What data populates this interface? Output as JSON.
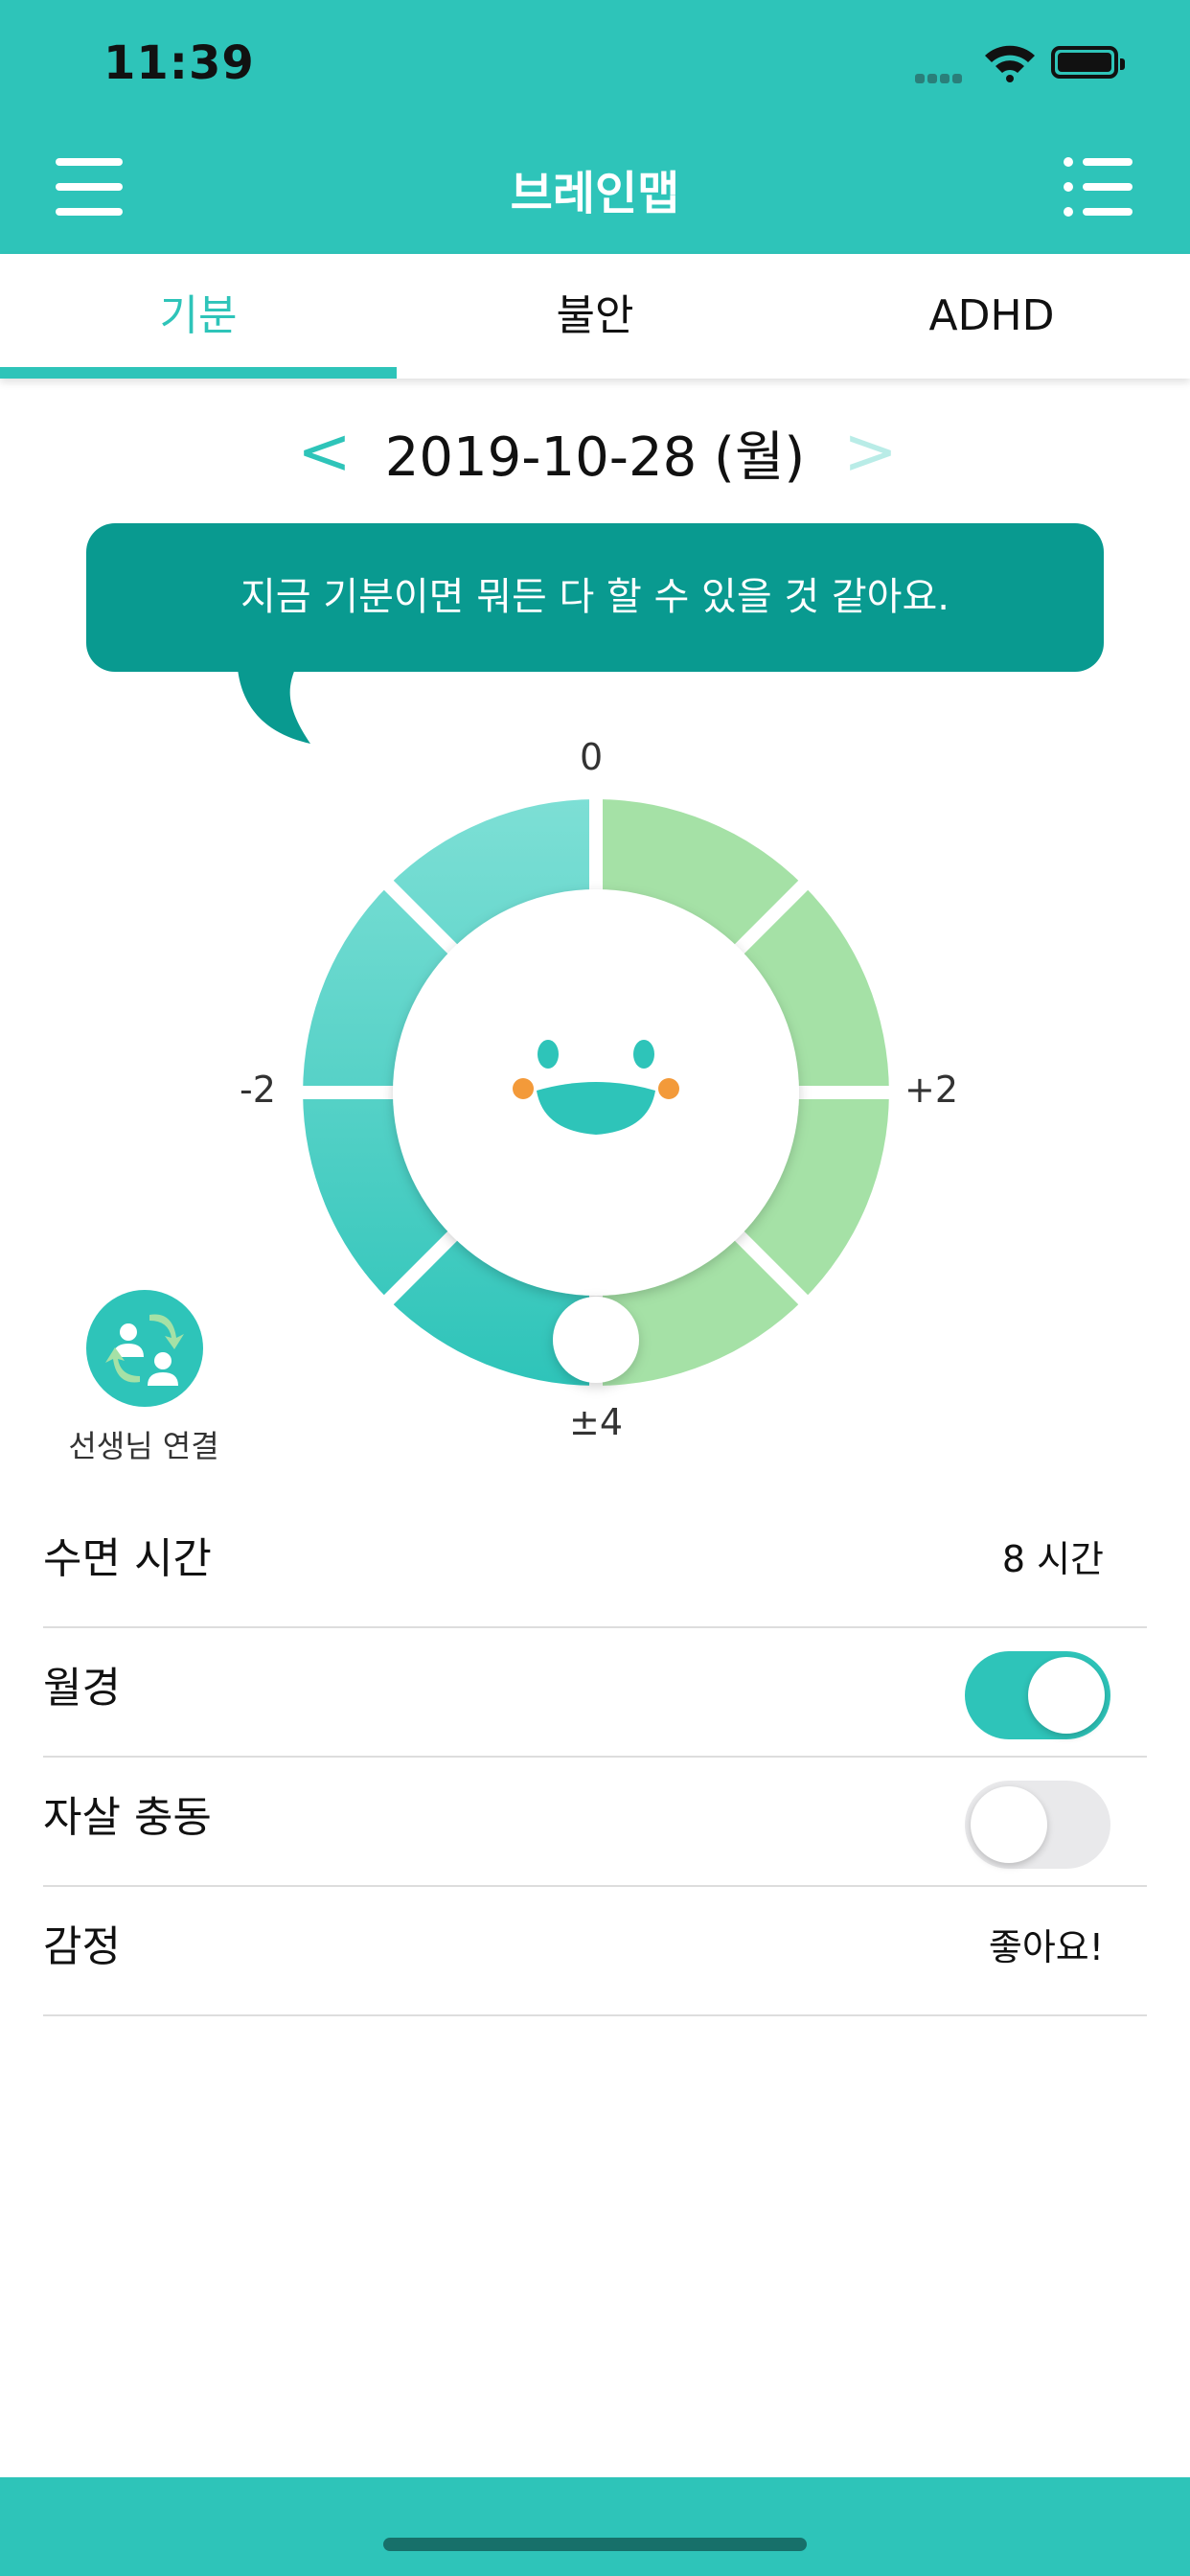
{
  "status_bar": {
    "time": "11:39"
  },
  "header": {
    "title": "브레인맵"
  },
  "tabs": [
    {
      "label": "기분",
      "active": true
    },
    {
      "label": "불안",
      "active": false
    },
    {
      "label": "ADHD",
      "active": false
    }
  ],
  "date_nav": {
    "prev": "<",
    "date": "2019-10-28 (월)",
    "next": ">"
  },
  "bubble": {
    "text": "지금 기분이면 뭐든 다 할 수 있을 것 같아요."
  },
  "wheel": {
    "labels": {
      "top": "0",
      "left": "-2",
      "right": "+2",
      "bottom": "±4"
    },
    "colors": {
      "left_side": "#5fd3c8",
      "right_side": "#a8e2a6",
      "center": "#ffffff",
      "face": "#2ec4b9",
      "cheeks": "#f39a3a"
    }
  },
  "teacher": {
    "label": "선생님 연결"
  },
  "settings": {
    "sleep": {
      "label": "수면 시간",
      "value": "8 시간"
    },
    "menstruation": {
      "label": "월경",
      "on": true
    },
    "suicidal": {
      "label": "자살 충동",
      "on": false
    },
    "emotion": {
      "label": "감정",
      "value": "좋아요!"
    }
  },
  "colors": {
    "accent": "#2ec4b9",
    "bubble": "#099a90"
  }
}
